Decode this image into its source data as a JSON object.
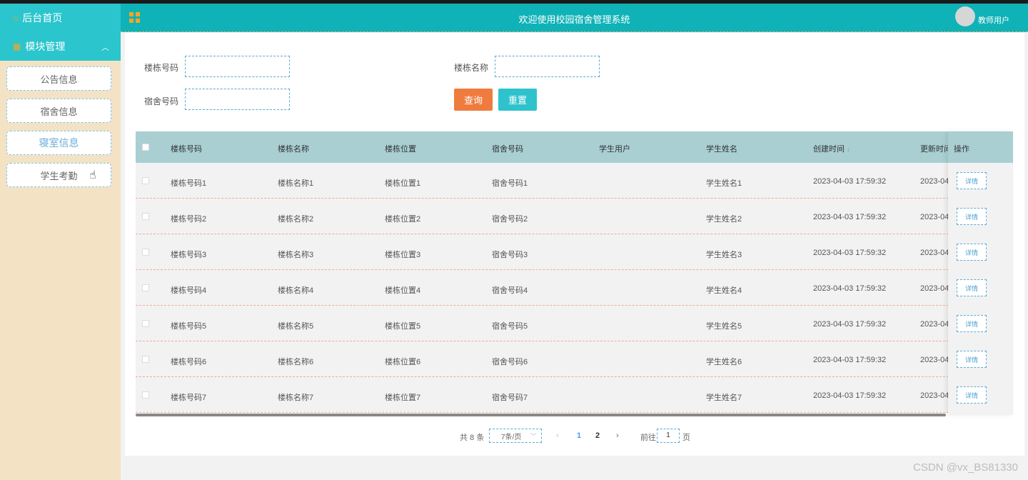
{
  "sidebar": {
    "home_label": "后台首页",
    "module_label": "模块管理",
    "items": [
      {
        "label": "公告信息"
      },
      {
        "label": "宿舍信息"
      },
      {
        "label": "寝室信息"
      },
      {
        "label": "学生考勤"
      }
    ]
  },
  "header": {
    "title": "欢迎使用校园宿舍管理系统",
    "user": "教师用户"
  },
  "search": {
    "building_no_label": "楼栋号码",
    "building_name_label": "楼栋名称",
    "dorm_no_label": "宿舍号码",
    "query_button": "查询",
    "reset_button": "重置"
  },
  "table": {
    "columns": [
      "楼栋号码",
      "楼栋名称",
      "楼栋位置",
      "宿舍号码",
      "学生用户",
      "学生姓名",
      "创建时间",
      "更新时间",
      "操作"
    ],
    "sort_indicator": "↕",
    "detail_label": "详情",
    "rows": [
      {
        "building_no": "楼栋号码1",
        "building_name": "楼栋名称1",
        "location": "楼栋位置1",
        "dorm_no": "宿舍号码1",
        "student_user": "",
        "student_name": "学生姓名1",
        "created": "2023-04-03 17:59:32",
        "updated": "2023-04-"
      },
      {
        "building_no": "楼栋号码2",
        "building_name": "楼栋名称2",
        "location": "楼栋位置2",
        "dorm_no": "宿舍号码2",
        "student_user": "",
        "student_name": "学生姓名2",
        "created": "2023-04-03 17:59:32",
        "updated": "2023-04-"
      },
      {
        "building_no": "楼栋号码3",
        "building_name": "楼栋名称3",
        "location": "楼栋位置3",
        "dorm_no": "宿舍号码3",
        "student_user": "",
        "student_name": "学生姓名3",
        "created": "2023-04-03 17:59:32",
        "updated": "2023-04-"
      },
      {
        "building_no": "楼栋号码4",
        "building_name": "楼栋名称4",
        "location": "楼栋位置4",
        "dorm_no": "宿舍号码4",
        "student_user": "",
        "student_name": "学生姓名4",
        "created": "2023-04-03 17:59:32",
        "updated": "2023-04-"
      },
      {
        "building_no": "楼栋号码5",
        "building_name": "楼栋名称5",
        "location": "楼栋位置5",
        "dorm_no": "宿舍号码5",
        "student_user": "",
        "student_name": "学生姓名5",
        "created": "2023-04-03 17:59:32",
        "updated": "2023-04-"
      },
      {
        "building_no": "楼栋号码6",
        "building_name": "楼栋名称6",
        "location": "楼栋位置6",
        "dorm_no": "宿舍号码6",
        "student_user": "",
        "student_name": "学生姓名6",
        "created": "2023-04-03 17:59:32",
        "updated": "2023-04-"
      },
      {
        "building_no": "楼栋号码7",
        "building_name": "楼栋名称7",
        "location": "楼栋位置7",
        "dorm_no": "宿舍号码7",
        "student_user": "",
        "student_name": "学生姓名7",
        "created": "2023-04-03 17:59:32",
        "updated": "2023-04-"
      }
    ]
  },
  "pagination": {
    "total": "共 8 条",
    "page_size": "7条/页",
    "prev": "‹",
    "pages": [
      "1",
      "2"
    ],
    "next": "›",
    "goto_prefix": "前往",
    "goto_value": "1",
    "goto_suffix": "页"
  },
  "watermark": "CSDN @vx_BS81330",
  "colors": {
    "header": "#0fb2b7",
    "sidebar_head": "#2ac5cd",
    "sidebar_bg": "#f3e2c3",
    "query": "#f07b3f",
    "reset": "#2ec3cc",
    "table_head": "#a9cfd3",
    "active_page": "#409eff"
  }
}
